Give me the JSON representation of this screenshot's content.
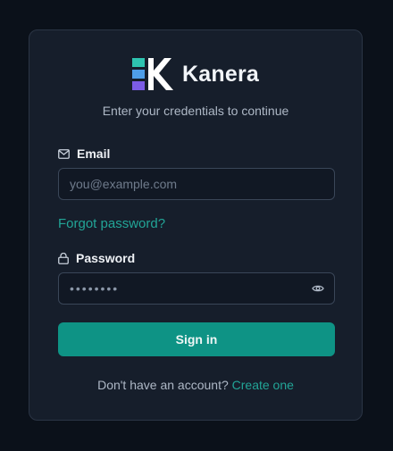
{
  "brand": {
    "name": "Kanera",
    "logo_colors": [
      "#2ec4b0",
      "#4e9ee8",
      "#7b5ce6",
      "#ffffff"
    ]
  },
  "subtitle": "Enter your credentials to continue",
  "email": {
    "label": "Email",
    "placeholder": "you@example.com",
    "value": "",
    "icon": "envelope-icon"
  },
  "forgot_password": "Forgot password?",
  "password": {
    "label": "Password",
    "value": "••••••••",
    "icon": "lock-icon",
    "toggle_icon": "eye-icon"
  },
  "submit_label": "Sign in",
  "footer": {
    "prompt": "Don't have an account?",
    "link": "Create one"
  },
  "colors": {
    "accent": "#22a597",
    "button": "#0e9385",
    "card": "#161e2b",
    "background": "#0b111a"
  }
}
